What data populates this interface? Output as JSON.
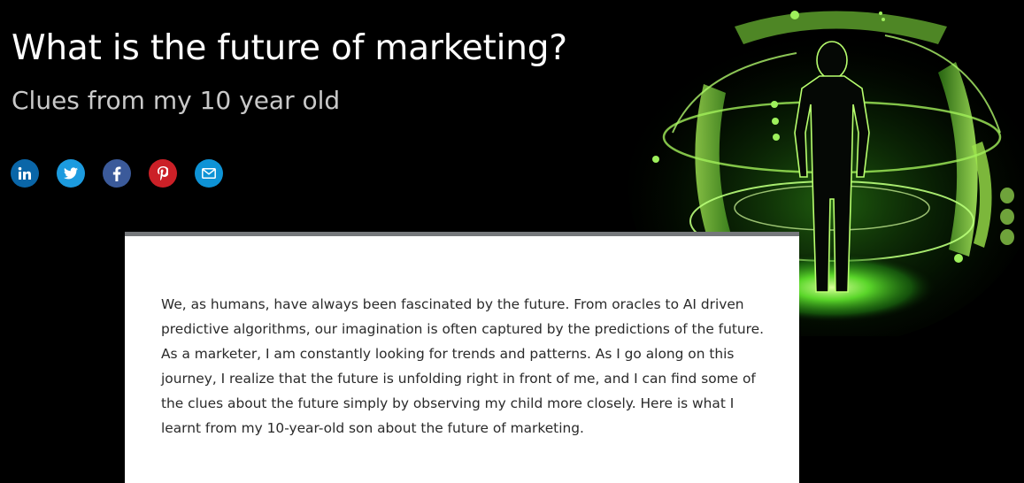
{
  "header": {
    "title": "What is the future of marketing?",
    "subtitle": "Clues from my 10 year old"
  },
  "share": {
    "buttons": [
      {
        "name": "linkedin",
        "icon": "linkedin-icon",
        "color": "#0a66a8"
      },
      {
        "name": "twitter",
        "icon": "twitter-icon",
        "color": "#1c9bdf"
      },
      {
        "name": "facebook",
        "icon": "facebook-icon",
        "color": "#3b5a9a"
      },
      {
        "name": "pinterest",
        "icon": "pinterest-icon",
        "color": "#cb2027"
      },
      {
        "name": "email",
        "icon": "email-icon",
        "color": "#0e93d6"
      }
    ]
  },
  "hero": {
    "image": "glowing-green-silhouette-of-person-in-hologram-rings",
    "accent": "#7cff3a"
  },
  "article": {
    "intro": "We, as humans, have always been fascinated by the future. From oracles to AI driven predictive algorithms, our imagination is often captured by the predictions of the future. As a marketer, I am constantly looking for trends and patterns. As I go along on this journey, I realize that the future is unfolding right in front of me, and I can find some of the clues about the future simply by observing my child more closely. Here is what I learnt from my 10-year-old son about the future of marketing."
  }
}
